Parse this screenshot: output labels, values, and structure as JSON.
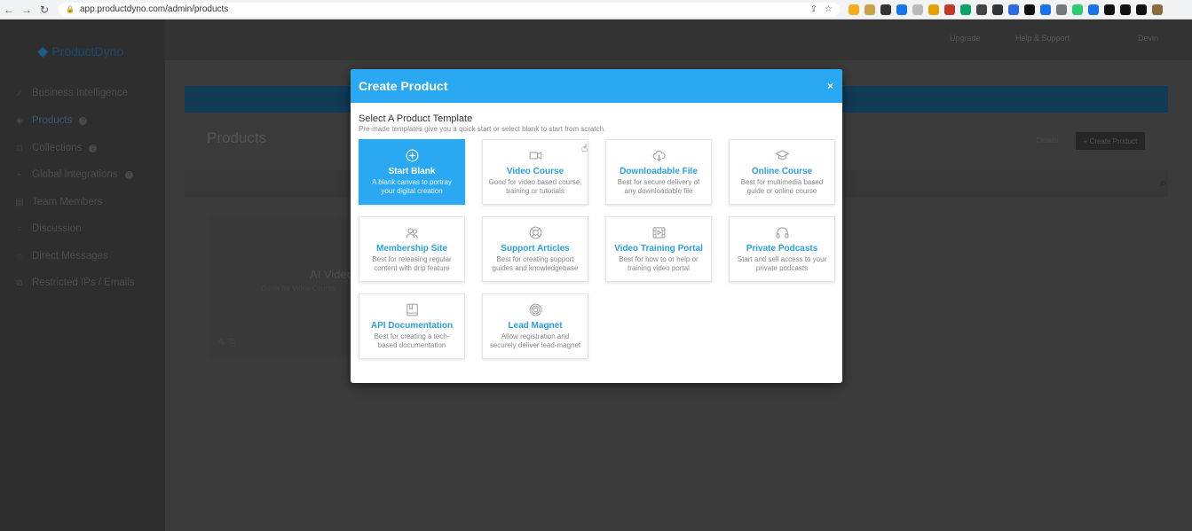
{
  "browser": {
    "url": "app.productdyno.com/admin/products",
    "ext_colors": [
      "#f2b01e",
      "#c9a34a",
      "#333",
      "#1a73e8",
      "#bbb",
      "#e8a000",
      "#c0392b",
      "#0fa36b",
      "#444",
      "#333",
      "#2d6cdf",
      "#111",
      "#1a73e8",
      "#777",
      "#2ecc71",
      "#1a73e8",
      "#111",
      "#111",
      "#111",
      "#8a6d3b"
    ]
  },
  "sidebar": {
    "logo_text": "ProductDyno",
    "items": [
      {
        "label": "Business Intelligence",
        "icon": "chart-icon"
      },
      {
        "label": "Products",
        "icon": "tag-icon"
      },
      {
        "label": "Collections",
        "icon": "folder-icon"
      },
      {
        "label": "Global Integrations",
        "icon": "plug-icon"
      },
      {
        "label": "Team Members",
        "icon": "users-icon"
      },
      {
        "label": "Discussion",
        "icon": "chat-icon"
      },
      {
        "label": "Direct Messages",
        "icon": "message-icon"
      },
      {
        "label": "Restricted IPs / Emails",
        "icon": "block-icon"
      }
    ]
  },
  "topbar": {
    "upgrade": "Upgrade",
    "help": "Help & Support",
    "user": "Devin"
  },
  "main": {
    "page_title": "Products",
    "details_label": "Details",
    "create_button": "+ Create Product",
    "card_title": "AI Video",
    "card_sub": "Guide for Video Course"
  },
  "modal": {
    "title": "Create Product",
    "close": "×",
    "select_title": "Select A Product Template",
    "select_sub": "Pre-made templates give you a quick start or select blank to start from scratch.",
    "templates": [
      {
        "name": "Start Blank",
        "desc": "A blank canvas to portray your digital creation",
        "icon": "plus-circle-icon",
        "selected": true
      },
      {
        "name": "Video Course",
        "desc": "Good for video based course, training or tutorials",
        "icon": "video-camera-icon"
      },
      {
        "name": "Downloadable File",
        "desc": "Best for secure delivery of any downloadable file",
        "icon": "cloud-download-icon"
      },
      {
        "name": "Online Course",
        "desc": "Best for multimedia based guide or online course",
        "icon": "graduation-cap-icon"
      },
      {
        "name": "Membership Site",
        "desc": "Best for releasing regular content with drip feature",
        "icon": "users-icon"
      },
      {
        "name": "Support Articles",
        "desc": "Best for creating support guides and knowledgebase",
        "icon": "lifebuoy-icon"
      },
      {
        "name": "Video Training Portal",
        "desc": "Best for how to or help or training video portal",
        "icon": "film-icon"
      },
      {
        "name": "Private Podcasts",
        "desc": "Start and sell access to your private podcasts",
        "icon": "headphones-icon"
      },
      {
        "name": "API Documentation",
        "desc": "Best for creating a tech-based documentation",
        "icon": "book-icon"
      },
      {
        "name": "Lead Magnet",
        "desc": "Allow registration and securely deliver lead-magnet",
        "icon": "target-icon"
      }
    ]
  },
  "colors": {
    "accent": "#2aa8f2",
    "overlay_bg": "#3a3a3a"
  }
}
